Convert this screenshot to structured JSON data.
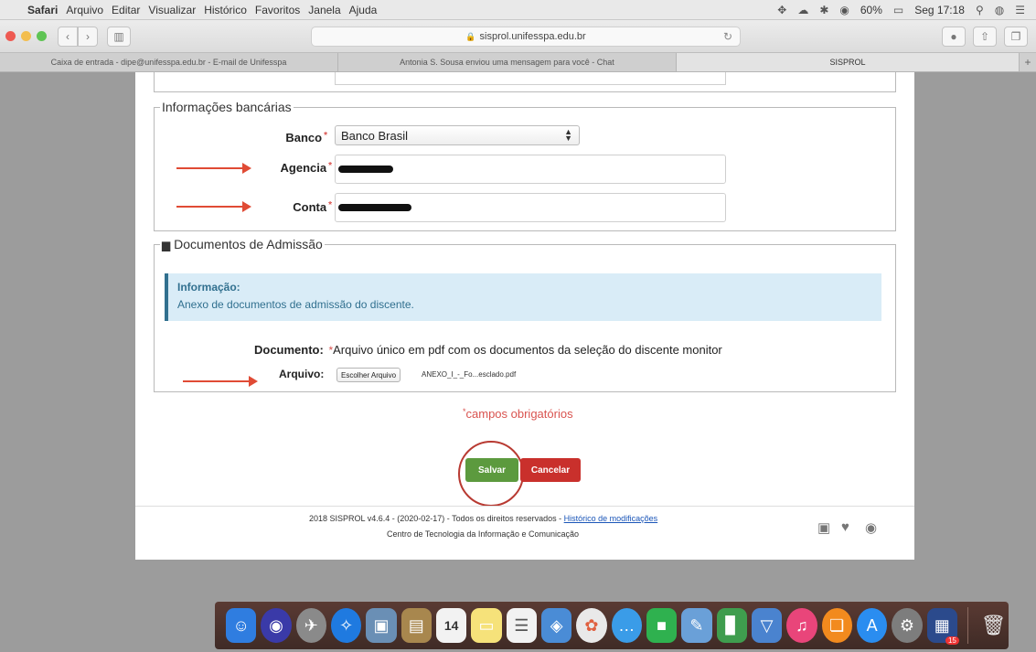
{
  "menubar": {
    "app": "Safari",
    "items": [
      "Arquivo",
      "Editar",
      "Visualizar",
      "Histórico",
      "Favoritos",
      "Janela",
      "Ajuda"
    ],
    "battery": "60%",
    "clock": "Seg 17:18"
  },
  "toolbar": {
    "url": "sisprol.unifesspa.edu.br"
  },
  "tabs": [
    "Caixa de entrada - dipe@unifesspa.edu.br - E-mail de Unifesspa",
    "Antonia S. Sousa enviou uma mensagem para você - Chat",
    "SISPROL"
  ],
  "form": {
    "bank_section_title": "Informações bancárias",
    "banco_label": "Banco",
    "banco_value": "Banco Brasil",
    "agencia_label": "Agencia",
    "conta_label": "Conta",
    "docs_section_title": "Documentos de Admissão",
    "info_title": "Informação:",
    "info_text": "Anexo de documentos de admissão do discente.",
    "documento_label": "Documento:",
    "documento_text": "Arquivo único em pdf com os documentos da seleção do discente monitor",
    "arquivo_label": "Arquivo:",
    "choose_file_button": "Escolher Arquivo",
    "file_name": "ANEXO_I_-_Fo...esclado.pdf",
    "required_note": "campos obrigatórios",
    "save_button": "Salvar",
    "cancel_button": "Cancelar"
  },
  "footer": {
    "line1": "2018 SISPROL v4.6.4 - (2020-02-17) - Todos os direitos reservados - ",
    "history_link": "Histórico de modificações",
    "line2": "Centro de Tecnologia da Informação e Comunicação"
  },
  "dock": {
    "calendar_day": "14",
    "badge_count": "15"
  },
  "colors": {
    "save": "#5c9a3e",
    "cancel": "#c9302c",
    "annotation": "#e04b35"
  }
}
